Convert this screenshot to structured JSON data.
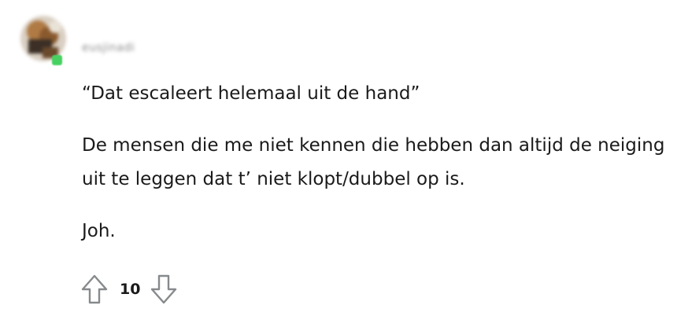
{
  "comment": {
    "username": "eusjinadi",
    "paragraphs": [
      "“Dat escaleert helemaal uit de hand”",
      "De mensen die me niet kennen die hebben dan altijd de neiging uit te leggen dat t’ niet klopt/dubbel op is.",
      "Joh."
    ],
    "score": "10",
    "icons": {
      "upvote": "upvote-arrow-icon",
      "downvote": "downvote-arrow-icon"
    },
    "colors": {
      "online": "#46d160",
      "text": "#1a1a1b",
      "icon": "#878a8c"
    }
  }
}
